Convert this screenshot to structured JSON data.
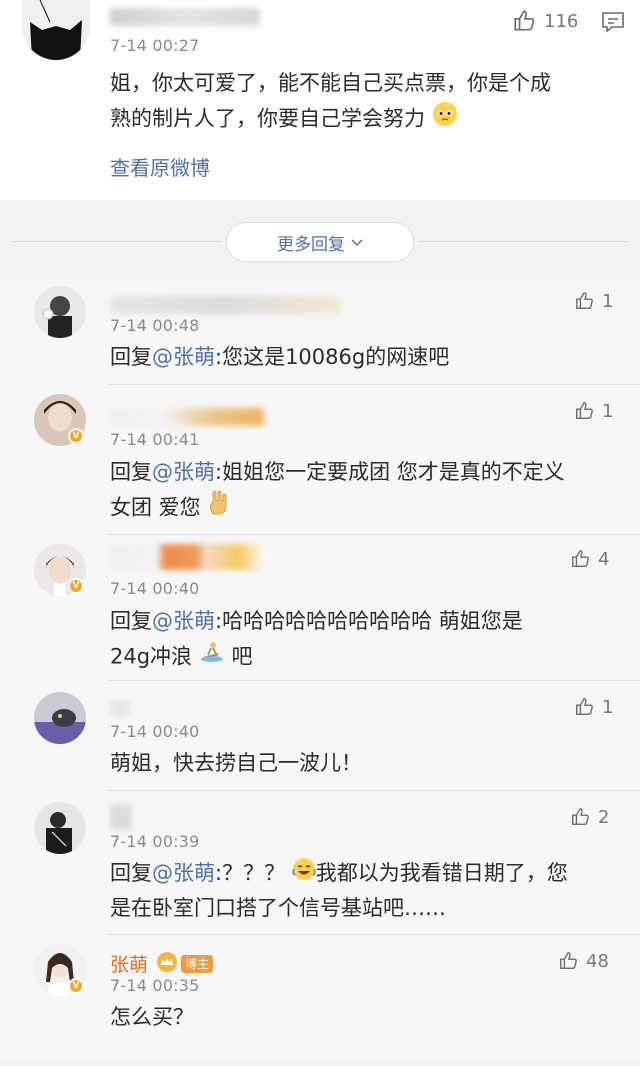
{
  "top_comment": {
    "time": "7-14 00:27",
    "likes": "116",
    "text_line1": "姐，你太可爱了，能不能自己买点票，你是个成",
    "text_line2": "熟的制片人了，你要自己学会努力",
    "view_original": "查看原微博"
  },
  "more_replies": {
    "label": "更多回复"
  },
  "replies": [
    {
      "time": "7-14 00:48",
      "likes": "1",
      "prefix": "回复",
      "mention": "@张萌",
      "text": ":您这是10086g的网速吧"
    },
    {
      "time": "7-14 00:41",
      "likes": "1",
      "prefix": "回复",
      "mention": "@张萌",
      "text": ":姐姐您一定要成团 您才是真的不定义",
      "text2": "女团 爱您"
    },
    {
      "time": "7-14 00:40",
      "likes": "4",
      "prefix": "回复",
      "mention": "@张萌",
      "text": ":哈哈哈哈哈哈哈哈哈哈 萌姐您是",
      "text2": "24g冲浪",
      "text2b": "吧"
    },
    {
      "time": "7-14 00:40",
      "likes": "1",
      "text": "萌姐，快去捞自己一波儿！"
    },
    {
      "time": "7-14 00:39",
      "likes": "2",
      "prefix": "回复",
      "mention": "@张萌",
      "text": ":？？？",
      "text_b": "我都以为我看错日期了，您",
      "text2": "是在卧室门口搭了个信号基站吧……"
    },
    {
      "name": "张萌",
      "badge": "博主",
      "time": "7-14 00:35",
      "likes": "48",
      "text": "怎么买？"
    }
  ],
  "colors": {
    "link": "#4e6fa8",
    "owner_name": "#e86c1c",
    "badge": "#f39a3c",
    "background": "#f2f2f2"
  }
}
